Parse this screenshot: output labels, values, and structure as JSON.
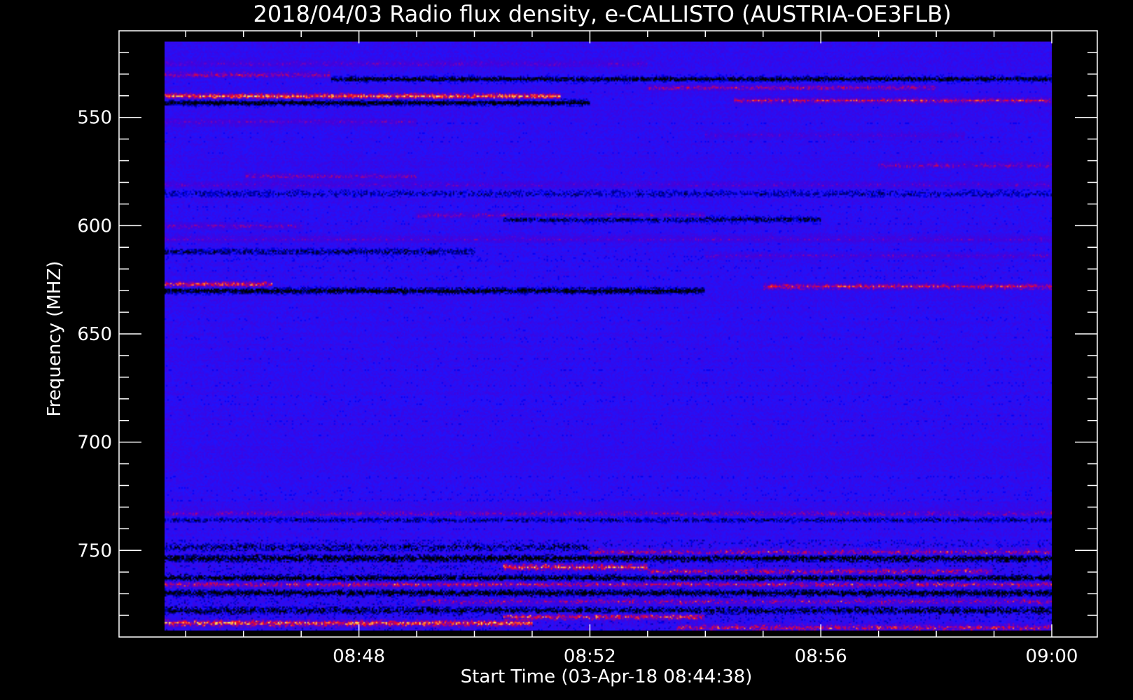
{
  "chart_data": {
    "type": "heatmap",
    "title": "2018/04/03  Radio flux density, e-CALLISTO (AUSTRIA-OE3FLB)",
    "xlabel": "Start Time (03-Apr-18 08:44:38)",
    "ylabel": "Frequency (MHZ)",
    "x_start": "08:44:38",
    "x_end": "09:00:00",
    "x_ticks": [
      {
        "value": "08:48",
        "minutes": 48
      },
      {
        "value": "08:52",
        "minutes": 52
      },
      {
        "value": "08:56",
        "minutes": 56
      },
      {
        "value": "09:00",
        "minutes": 60
      }
    ],
    "y_ticks": [
      550,
      600,
      650,
      700,
      750
    ],
    "ylim": [
      510,
      790
    ],
    "data_ylim": [
      515,
      787
    ],
    "y_inverted": true,
    "colormap": [
      "#000000",
      "#1010ff",
      "#ff2020",
      "#ffff60"
    ],
    "background_level": "#1a1ad8",
    "bands": [
      {
        "freq": 525,
        "intensity": 0.35,
        "t0": 44.6,
        "t1": 53.0
      },
      {
        "freq": 530,
        "intensity": 0.6,
        "t0": 44.6,
        "t1": 47.5
      },
      {
        "freq": 532,
        "intensity": -0.8,
        "t0": 47.5,
        "t1": 60.0
      },
      {
        "freq": 536,
        "intensity": 0.55,
        "t0": 53.0,
        "t1": 58.0
      },
      {
        "freq": 540,
        "intensity": 1.0,
        "t0": 44.6,
        "t1": 51.5
      },
      {
        "freq": 543,
        "intensity": -1.0,
        "t0": 44.6,
        "t1": 52.0
      },
      {
        "freq": 542,
        "intensity": 0.7,
        "t0": 54.5,
        "t1": 60.0
      },
      {
        "freq": 552,
        "intensity": 0.4,
        "t0": 44.6,
        "t1": 49.0
      },
      {
        "freq": 558,
        "intensity": 0.35,
        "t0": 54.0,
        "t1": 58.5
      },
      {
        "freq": 572,
        "intensity": 0.45,
        "t0": 57.0,
        "t1": 60.0
      },
      {
        "freq": 577,
        "intensity": 0.5,
        "t0": 46.0,
        "t1": 49.0
      },
      {
        "freq": 581,
        "intensity": 0.4,
        "t0": 44.6,
        "t1": 60.0
      },
      {
        "freq": 585,
        "intensity": -0.5,
        "t0": 44.6,
        "t1": 60.0
      },
      {
        "freq": 595,
        "intensity": 0.5,
        "t0": 49.0,
        "t1": 54.0
      },
      {
        "freq": 597,
        "intensity": -0.7,
        "t0": 50.5,
        "t1": 56.0
      },
      {
        "freq": 600,
        "intensity": 0.45,
        "t0": 44.6,
        "t1": 47.0
      },
      {
        "freq": 606,
        "intensity": 0.35,
        "t0": 44.6,
        "t1": 60.0
      },
      {
        "freq": 612,
        "intensity": -0.6,
        "t0": 44.6,
        "t1": 50.0
      },
      {
        "freq": 614,
        "intensity": 0.4,
        "t0": 54.0,
        "t1": 60.0
      },
      {
        "freq": 627,
        "intensity": 0.9,
        "t0": 44.6,
        "t1": 46.5
      },
      {
        "freq": 628,
        "intensity": 0.75,
        "t0": 55.0,
        "t1": 60.0
      },
      {
        "freq": 630,
        "intensity": -1.0,
        "t0": 44.6,
        "t1": 54.0
      },
      {
        "freq": 733,
        "intensity": 0.5,
        "t0": 44.6,
        "t1": 60.0
      },
      {
        "freq": 736,
        "intensity": -0.5,
        "t0": 44.6,
        "t1": 60.0
      },
      {
        "freq": 749,
        "intensity": -0.6,
        "t0": 44.6,
        "t1": 52.0
      },
      {
        "freq": 751,
        "intensity": 0.55,
        "t0": 52.0,
        "t1": 60.0
      },
      {
        "freq": 754,
        "intensity": -1.0,
        "t0": 44.6,
        "t1": 60.0
      },
      {
        "freq": 758,
        "intensity": 0.95,
        "t0": 50.5,
        "t1": 53.0
      },
      {
        "freq": 760,
        "intensity": 0.65,
        "t0": 53.0,
        "t1": 59.0
      },
      {
        "freq": 763,
        "intensity": -0.9,
        "t0": 44.6,
        "t1": 60.0
      },
      {
        "freq": 766,
        "intensity": 0.6,
        "t0": 44.6,
        "t1": 60.0
      },
      {
        "freq": 770,
        "intensity": -0.9,
        "t0": 44.6,
        "t1": 60.0
      },
      {
        "freq": 774,
        "intensity": 0.55,
        "t0": 49.0,
        "t1": 60.0
      },
      {
        "freq": 778,
        "intensity": -0.8,
        "t0": 44.6,
        "t1": 60.0
      },
      {
        "freq": 781,
        "intensity": 0.85,
        "t0": 50.5,
        "t1": 54.0
      },
      {
        "freq": 784,
        "intensity": 1.0,
        "t0": 44.6,
        "t1": 51.0
      },
      {
        "freq": 786,
        "intensity": 0.7,
        "t0": 53.5,
        "t1": 60.0
      }
    ],
    "grid": false,
    "legend": "none"
  }
}
